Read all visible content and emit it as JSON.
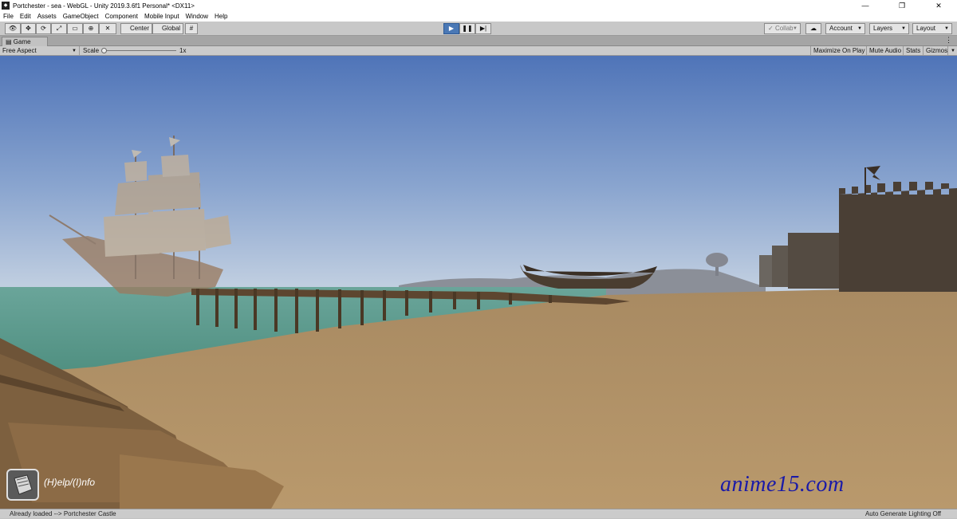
{
  "window": {
    "title": "Portchester - sea - WebGL - Unity 2019.3.6f1 Personal* <DX11>"
  },
  "menu": [
    "File",
    "Edit",
    "Assets",
    "GameObject",
    "Component",
    "Mobile Input",
    "Window",
    "Help"
  ],
  "toolbar": {
    "pivot_label": "Center",
    "space_label": "Global",
    "collab_label": "Collab",
    "account_label": "Account",
    "layers_label": "Layers",
    "layout_label": "Layout"
  },
  "game_tab": {
    "label": "Game"
  },
  "game_bar": {
    "aspect": "Free Aspect",
    "scale_label": "Scale",
    "scale_value": "1x",
    "maximize": "Maximize On Play",
    "mute": "Mute Audio",
    "stats": "Stats",
    "gizmos": "Gizmos"
  },
  "hud": {
    "help_text": "(H)elp/(I)nfo"
  },
  "watermark": "anime15.com",
  "status": {
    "message": "Already loaded --> Portchester Castle",
    "lighting": "Auto Generate Lighting Off"
  },
  "colors": {
    "play_active": "#4a78b5",
    "sky_top": "#4f74b8",
    "sand": "#b39468",
    "sea": "#5b9a8c"
  }
}
